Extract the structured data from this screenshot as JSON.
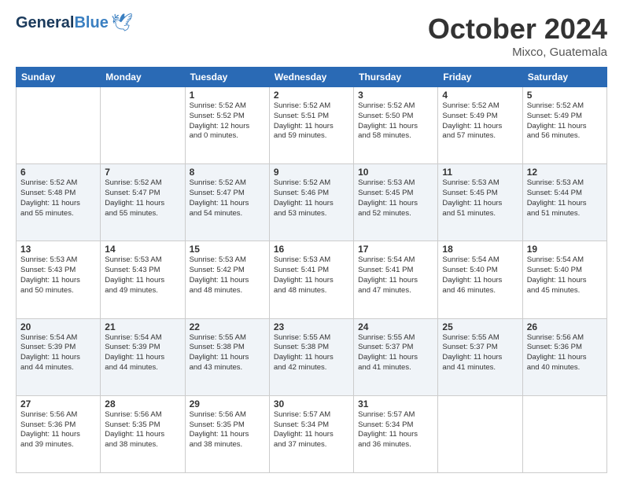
{
  "header": {
    "logo_line1": "General",
    "logo_line2": "Blue",
    "month": "October 2024",
    "location": "Mixco, Guatemala"
  },
  "weekdays": [
    "Sunday",
    "Monday",
    "Tuesday",
    "Wednesday",
    "Thursday",
    "Friday",
    "Saturday"
  ],
  "weeks": [
    [
      {
        "day": "",
        "info": ""
      },
      {
        "day": "",
        "info": ""
      },
      {
        "day": "1",
        "info": "Sunrise: 5:52 AM\nSunset: 5:52 PM\nDaylight: 12 hours\nand 0 minutes."
      },
      {
        "day": "2",
        "info": "Sunrise: 5:52 AM\nSunset: 5:51 PM\nDaylight: 11 hours\nand 59 minutes."
      },
      {
        "day": "3",
        "info": "Sunrise: 5:52 AM\nSunset: 5:50 PM\nDaylight: 11 hours\nand 58 minutes."
      },
      {
        "day": "4",
        "info": "Sunrise: 5:52 AM\nSunset: 5:49 PM\nDaylight: 11 hours\nand 57 minutes."
      },
      {
        "day": "5",
        "info": "Sunrise: 5:52 AM\nSunset: 5:49 PM\nDaylight: 11 hours\nand 56 minutes."
      }
    ],
    [
      {
        "day": "6",
        "info": "Sunrise: 5:52 AM\nSunset: 5:48 PM\nDaylight: 11 hours\nand 55 minutes."
      },
      {
        "day": "7",
        "info": "Sunrise: 5:52 AM\nSunset: 5:47 PM\nDaylight: 11 hours\nand 55 minutes."
      },
      {
        "day": "8",
        "info": "Sunrise: 5:52 AM\nSunset: 5:47 PM\nDaylight: 11 hours\nand 54 minutes."
      },
      {
        "day": "9",
        "info": "Sunrise: 5:52 AM\nSunset: 5:46 PM\nDaylight: 11 hours\nand 53 minutes."
      },
      {
        "day": "10",
        "info": "Sunrise: 5:53 AM\nSunset: 5:45 PM\nDaylight: 11 hours\nand 52 minutes."
      },
      {
        "day": "11",
        "info": "Sunrise: 5:53 AM\nSunset: 5:45 PM\nDaylight: 11 hours\nand 51 minutes."
      },
      {
        "day": "12",
        "info": "Sunrise: 5:53 AM\nSunset: 5:44 PM\nDaylight: 11 hours\nand 51 minutes."
      }
    ],
    [
      {
        "day": "13",
        "info": "Sunrise: 5:53 AM\nSunset: 5:43 PM\nDaylight: 11 hours\nand 50 minutes."
      },
      {
        "day": "14",
        "info": "Sunrise: 5:53 AM\nSunset: 5:43 PM\nDaylight: 11 hours\nand 49 minutes."
      },
      {
        "day": "15",
        "info": "Sunrise: 5:53 AM\nSunset: 5:42 PM\nDaylight: 11 hours\nand 48 minutes."
      },
      {
        "day": "16",
        "info": "Sunrise: 5:53 AM\nSunset: 5:41 PM\nDaylight: 11 hours\nand 48 minutes."
      },
      {
        "day": "17",
        "info": "Sunrise: 5:54 AM\nSunset: 5:41 PM\nDaylight: 11 hours\nand 47 minutes."
      },
      {
        "day": "18",
        "info": "Sunrise: 5:54 AM\nSunset: 5:40 PM\nDaylight: 11 hours\nand 46 minutes."
      },
      {
        "day": "19",
        "info": "Sunrise: 5:54 AM\nSunset: 5:40 PM\nDaylight: 11 hours\nand 45 minutes."
      }
    ],
    [
      {
        "day": "20",
        "info": "Sunrise: 5:54 AM\nSunset: 5:39 PM\nDaylight: 11 hours\nand 44 minutes."
      },
      {
        "day": "21",
        "info": "Sunrise: 5:54 AM\nSunset: 5:39 PM\nDaylight: 11 hours\nand 44 minutes."
      },
      {
        "day": "22",
        "info": "Sunrise: 5:55 AM\nSunset: 5:38 PM\nDaylight: 11 hours\nand 43 minutes."
      },
      {
        "day": "23",
        "info": "Sunrise: 5:55 AM\nSunset: 5:38 PM\nDaylight: 11 hours\nand 42 minutes."
      },
      {
        "day": "24",
        "info": "Sunrise: 5:55 AM\nSunset: 5:37 PM\nDaylight: 11 hours\nand 41 minutes."
      },
      {
        "day": "25",
        "info": "Sunrise: 5:55 AM\nSunset: 5:37 PM\nDaylight: 11 hours\nand 41 minutes."
      },
      {
        "day": "26",
        "info": "Sunrise: 5:56 AM\nSunset: 5:36 PM\nDaylight: 11 hours\nand 40 minutes."
      }
    ],
    [
      {
        "day": "27",
        "info": "Sunrise: 5:56 AM\nSunset: 5:36 PM\nDaylight: 11 hours\nand 39 minutes."
      },
      {
        "day": "28",
        "info": "Sunrise: 5:56 AM\nSunset: 5:35 PM\nDaylight: 11 hours\nand 38 minutes."
      },
      {
        "day": "29",
        "info": "Sunrise: 5:56 AM\nSunset: 5:35 PM\nDaylight: 11 hours\nand 38 minutes."
      },
      {
        "day": "30",
        "info": "Sunrise: 5:57 AM\nSunset: 5:34 PM\nDaylight: 11 hours\nand 37 minutes."
      },
      {
        "day": "31",
        "info": "Sunrise: 5:57 AM\nSunset: 5:34 PM\nDaylight: 11 hours\nand 36 minutes."
      },
      {
        "day": "",
        "info": ""
      },
      {
        "day": "",
        "info": ""
      }
    ]
  ]
}
